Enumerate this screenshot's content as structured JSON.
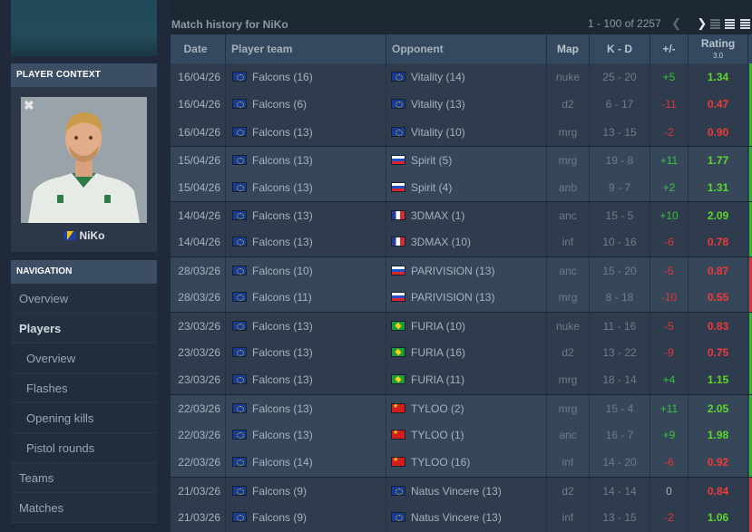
{
  "sidebar": {
    "player_context_title": "PLAYER CONTEXT",
    "close_icon": "close-icon",
    "player_name": "NiKo",
    "player_flag": "BA",
    "navigation_title": "NAVIGATION",
    "nav_items": [
      {
        "label": "Overview"
      },
      {
        "label": "Players"
      },
      {
        "label": "Overview"
      },
      {
        "label": "Flashes"
      },
      {
        "label": "Opening kills"
      },
      {
        "label": "Pistol rounds"
      },
      {
        "label": "Teams"
      },
      {
        "label": "Matches"
      }
    ]
  },
  "main": {
    "title": "Match history for NiKo",
    "pagination": "1 - 100 of 2257",
    "headers": {
      "date": "Date",
      "team": "Player team",
      "opponent": "Opponent",
      "map": "Map",
      "kd": "K - D",
      "diff": "+/-",
      "rating": "Rating",
      "rating_version": "3.0"
    },
    "rows": [
      {
        "date": "16/04/26",
        "team": "Falcons (16)",
        "team_flag": "eu",
        "opponent": "Vitality (14)",
        "opp_flag": "eu",
        "map": "nuke",
        "kd": "25 - 20",
        "diff": "+5",
        "rating": "1.34",
        "result": "win"
      },
      {
        "date": "16/04/26",
        "team": "Falcons (6)",
        "team_flag": "eu",
        "opponent": "Vitality (13)",
        "opp_flag": "eu",
        "map": "d2",
        "kd": "6 - 17",
        "diff": "-11",
        "rating": "0.47",
        "result": "win"
      },
      {
        "date": "16/04/26",
        "team": "Falcons (13)",
        "team_flag": "eu",
        "opponent": "Vitality (10)",
        "opp_flag": "eu",
        "map": "mrg",
        "kd": "13 - 15",
        "diff": "-2",
        "rating": "0.90",
        "result": "win"
      },
      {
        "date": "15/04/26",
        "team": "Falcons (13)",
        "team_flag": "eu",
        "opponent": "Spirit (5)",
        "opp_flag": "ru",
        "map": "mrg",
        "kd": "19 - 8",
        "diff": "+11",
        "rating": "1.77",
        "result": "win"
      },
      {
        "date": "15/04/26",
        "team": "Falcons (13)",
        "team_flag": "eu",
        "opponent": "Spirit (4)",
        "opp_flag": "ru",
        "map": "anb",
        "kd": "9 - 7",
        "diff": "+2",
        "rating": "1.31",
        "result": "win"
      },
      {
        "date": "14/04/26",
        "team": "Falcons (13)",
        "team_flag": "eu",
        "opponent": "3DMAX (1)",
        "opp_flag": "fr",
        "map": "anc",
        "kd": "15 - 5",
        "diff": "+10",
        "rating": "2.09",
        "result": "win"
      },
      {
        "date": "14/04/26",
        "team": "Falcons (13)",
        "team_flag": "eu",
        "opponent": "3DMAX (10)",
        "opp_flag": "fr",
        "map": "inf",
        "kd": "10 - 16",
        "diff": "-6",
        "rating": "0.78",
        "result": "win"
      },
      {
        "date": "28/03/26",
        "team": "Falcons (10)",
        "team_flag": "eu",
        "opponent": "PARIVISION (13)",
        "opp_flag": "ru",
        "map": "anc",
        "kd": "15 - 20",
        "diff": "-5",
        "rating": "0.87",
        "result": "loss"
      },
      {
        "date": "28/03/26",
        "team": "Falcons (11)",
        "team_flag": "eu",
        "opponent": "PARIVISION (13)",
        "opp_flag": "ru",
        "map": "mrg",
        "kd": "8 - 18",
        "diff": "-10",
        "rating": "0.55",
        "result": "loss"
      },
      {
        "date": "23/03/26",
        "team": "Falcons (13)",
        "team_flag": "eu",
        "opponent": "FURIA (10)",
        "opp_flag": "br",
        "map": "nuke",
        "kd": "11 - 16",
        "diff": "-5",
        "rating": "0.83",
        "result": "win"
      },
      {
        "date": "23/03/26",
        "team": "Falcons (13)",
        "team_flag": "eu",
        "opponent": "FURIA (16)",
        "opp_flag": "br",
        "map": "d2",
        "kd": "13 - 22",
        "diff": "-9",
        "rating": "0.75",
        "result": "win"
      },
      {
        "date": "23/03/26",
        "team": "Falcons (13)",
        "team_flag": "eu",
        "opponent": "FURIA (11)",
        "opp_flag": "br",
        "map": "mrg",
        "kd": "18 - 14",
        "diff": "+4",
        "rating": "1.15",
        "result": "win"
      },
      {
        "date": "22/03/26",
        "team": "Falcons (13)",
        "team_flag": "eu",
        "opponent": "TYLOO (2)",
        "opp_flag": "cn",
        "map": "mrg",
        "kd": "15 - 4",
        "diff": "+11",
        "rating": "2.05",
        "result": "win"
      },
      {
        "date": "22/03/26",
        "team": "Falcons (13)",
        "team_flag": "eu",
        "opponent": "TYLOO (1)",
        "opp_flag": "cn",
        "map": "anc",
        "kd": "16 - 7",
        "diff": "+9",
        "rating": "1.98",
        "result": "win"
      },
      {
        "date": "22/03/26",
        "team": "Falcons (14)",
        "team_flag": "eu",
        "opponent": "TYLOO (16)",
        "opp_flag": "cn",
        "map": "inf",
        "kd": "14 - 20",
        "diff": "-6",
        "rating": "0.92",
        "result": "win"
      },
      {
        "date": "21/03/26",
        "team": "Falcons (9)",
        "team_flag": "eu",
        "opponent": "Natus Vincere (13)",
        "opp_flag": "eu",
        "map": "d2",
        "kd": "14 - 14",
        "diff": "0",
        "rating": "0.84",
        "result": "loss"
      },
      {
        "date": "21/03/26",
        "team": "Falcons (9)",
        "team_flag": "eu",
        "opponent": "Natus Vincere (13)",
        "opp_flag": "eu",
        "map": "inf",
        "kd": "13 - 15",
        "diff": "-2",
        "rating": "1.06",
        "result": "loss"
      }
    ],
    "groups": [
      0,
      0,
      0,
      1,
      1,
      2,
      2,
      3,
      3,
      4,
      4,
      4,
      5,
      5,
      5,
      6,
      6
    ]
  },
  "colors": {
    "win": "#2fba2f",
    "loss": "#d63636",
    "positive": "#36c23c",
    "negative": "#e23535",
    "rating_good": "#5dd62c",
    "rating_bad": "#f03a3a"
  }
}
